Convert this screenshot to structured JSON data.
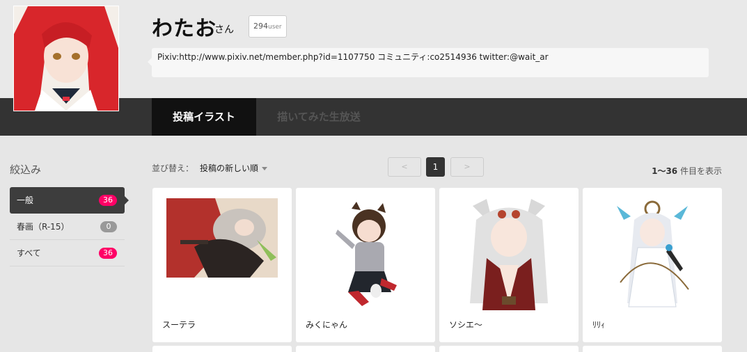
{
  "profile": {
    "name": "わたお",
    "honorific": "さん",
    "user_count": "294",
    "user_count_unit": "user",
    "bio": "Pixiv:http://www.pixiv.net/member.php?id=1107750 コミュニティ:co2514936 twitter:@wait_ar"
  },
  "tabs": [
    {
      "label": "投稿イラスト",
      "active": true
    },
    {
      "label": "描いてみた生放送",
      "active": false
    }
  ],
  "sidebar": {
    "title": "絞込み",
    "items": [
      {
        "label": "一般",
        "count": "36",
        "active": true
      },
      {
        "label": "春画（R-15）",
        "count": "0",
        "active": false
      },
      {
        "label": "すべて",
        "count": "36",
        "active": false
      }
    ]
  },
  "toolbar": {
    "sort_label": "並び替え：",
    "sort_value": "投稿の新しい順",
    "prev": "<",
    "page": "1",
    "next": ">",
    "result_range": "1〜36",
    "result_suffix": " 件目を表示"
  },
  "cards": [
    {
      "title": "スーテラ"
    },
    {
      "title": "みくにゃん"
    },
    {
      "title": "ソシエ〜"
    },
    {
      "title": "ﾘﾘｨ"
    }
  ],
  "colors": {
    "accent": "#ff0066",
    "tabbar": "#333333",
    "tab_active": "#111111"
  }
}
